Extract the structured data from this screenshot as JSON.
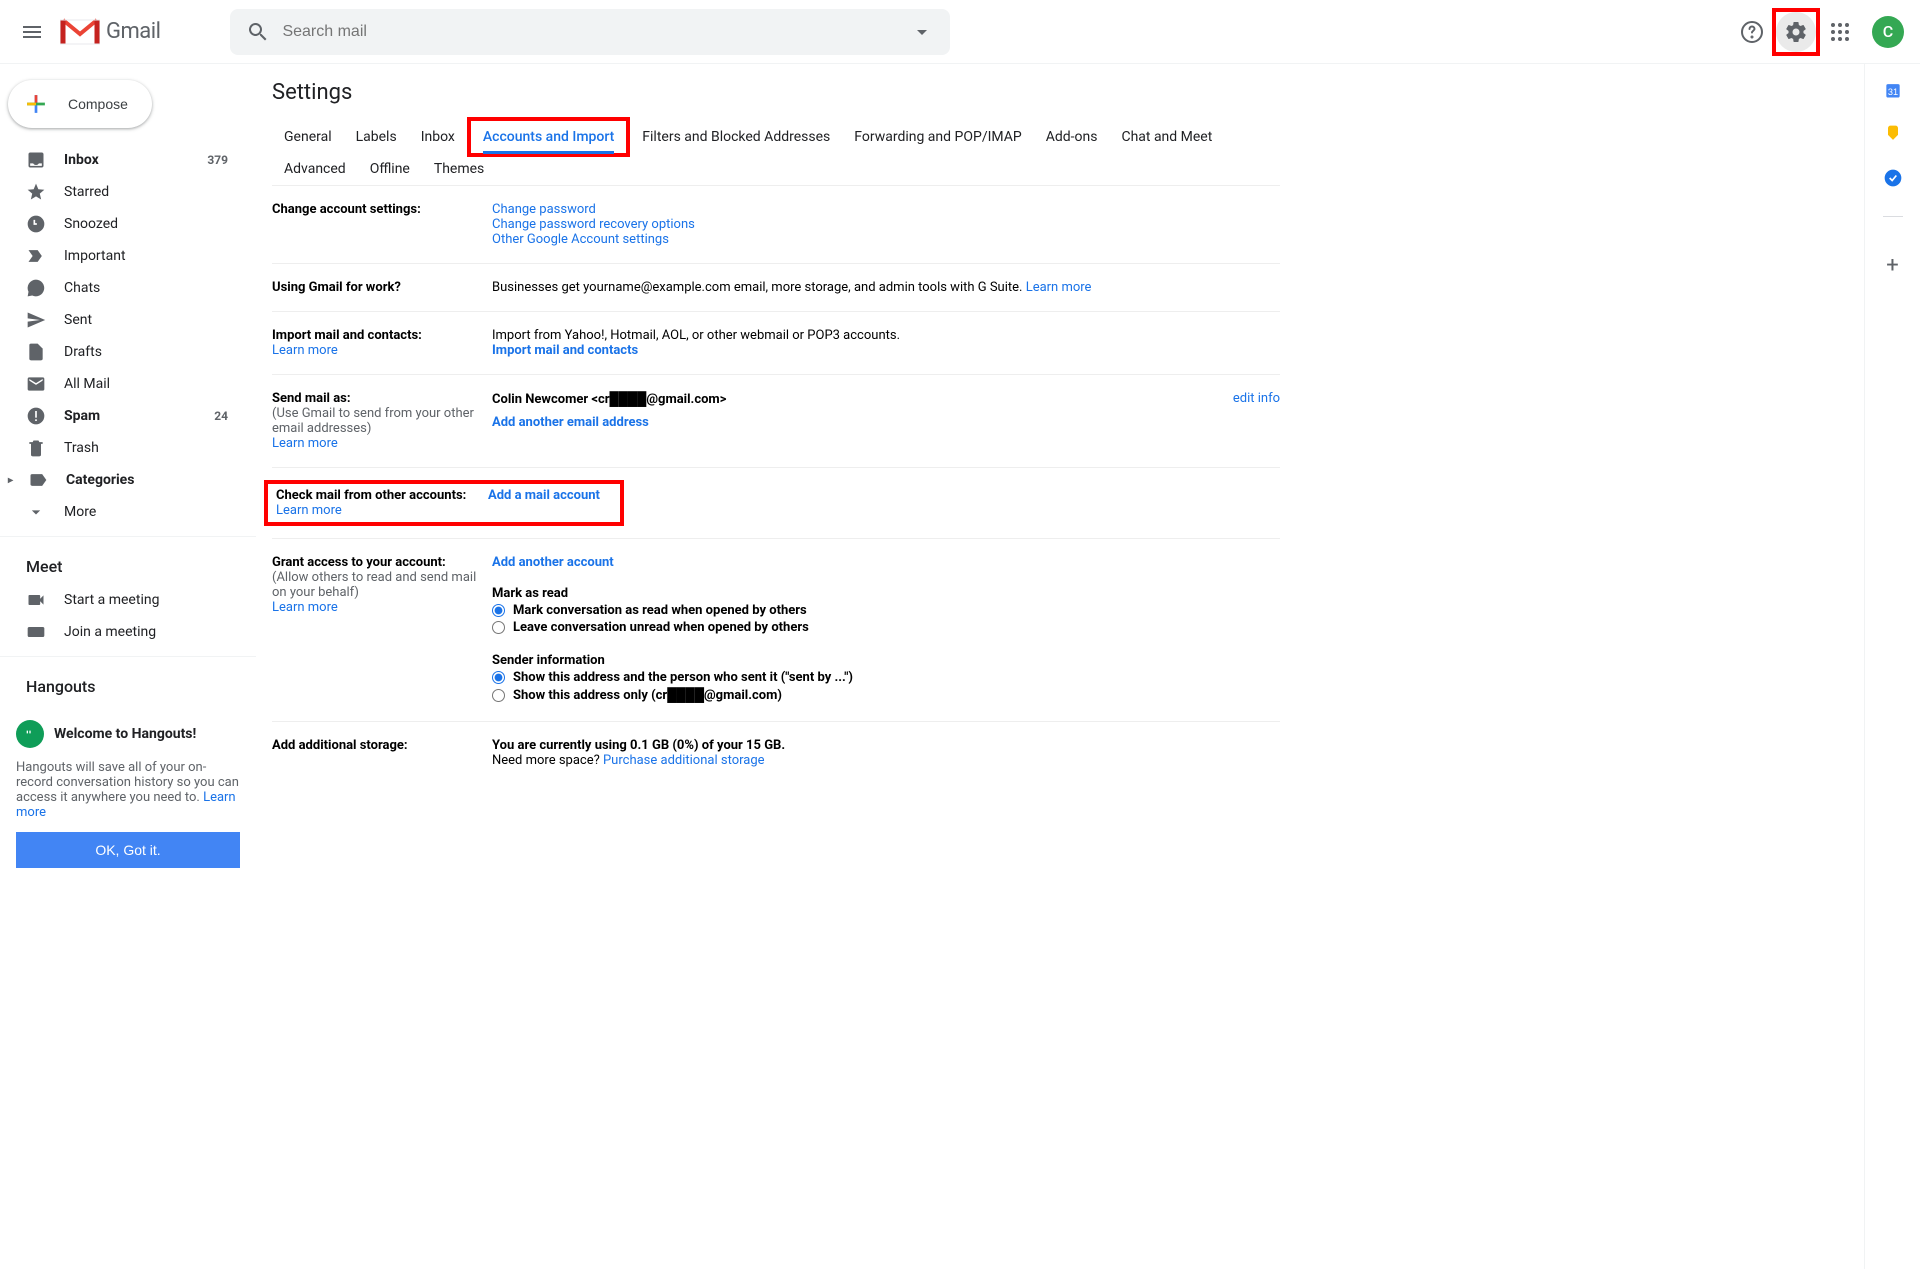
{
  "header": {
    "logo_text": "Gmail",
    "search_placeholder": "Search mail",
    "avatar_letter": "C"
  },
  "sidebar": {
    "compose": "Compose",
    "nav": [
      {
        "label": "Inbox",
        "count": "379",
        "bold": true
      },
      {
        "label": "Starred"
      },
      {
        "label": "Snoozed"
      },
      {
        "label": "Important"
      },
      {
        "label": "Chats"
      },
      {
        "label": "Sent"
      },
      {
        "label": "Drafts"
      },
      {
        "label": "All Mail"
      },
      {
        "label": "Spam",
        "count": "24",
        "bold": true
      },
      {
        "label": "Trash"
      },
      {
        "label": "Categories",
        "bold": true,
        "chevron": true
      },
      {
        "label": "More",
        "expand_icon": true
      }
    ],
    "meet_title": "Meet",
    "meet_start": "Start a meeting",
    "meet_join": "Join a meeting",
    "hangouts_title": "Hangouts",
    "hangouts_welcome": "Welcome to Hangouts!",
    "hangouts_body": "Hangouts will save all of your on-record conversation history so you can access it anywhere you need to. ",
    "hangouts_learn": "Learn more",
    "hangouts_ok": "OK, Got it."
  },
  "settings": {
    "title": "Settings",
    "tabs": [
      "General",
      "Labels",
      "Inbox",
      "Accounts and Import",
      "Filters and Blocked Addresses",
      "Forwarding and POP/IMAP",
      "Add-ons",
      "Chat and Meet",
      "Advanced",
      "Offline",
      "Themes"
    ],
    "active_tab": "Accounts and Import",
    "sections": {
      "change_account": {
        "label": "Change account settings:",
        "links": [
          "Change password",
          "Change password recovery options",
          "Other Google Account settings"
        ]
      },
      "gmail_work": {
        "label": "Using Gmail for work?",
        "text": "Businesses get yourname@example.com email, more storage, and admin tools with G Suite. ",
        "learn": "Learn more"
      },
      "import_mail": {
        "label": "Import mail and contacts:",
        "learn": "Learn more",
        "text": "Import from Yahoo!, Hotmail, AOL, or other webmail or POP3 accounts.",
        "action": "Import mail and contacts"
      },
      "send_as": {
        "label": "Send mail as:",
        "sub": "(Use Gmail to send from your other email addresses)",
        "learn": "Learn more",
        "name": "Colin Newcomer <cr████@gmail.com>",
        "action": "Add another email address",
        "edit": "edit info"
      },
      "check_mail": {
        "label": "Check mail from other accounts:",
        "learn": "Learn more",
        "action": "Add a mail account"
      },
      "grant_access": {
        "label": "Grant access to your account:",
        "sub": "(Allow others to read and send mail on your behalf)",
        "learn": "Learn more",
        "action": "Add another account",
        "mark_title": "Mark as read",
        "mark_opt1": "Mark conversation as read when opened by others",
        "mark_opt2": "Leave conversation unread when opened by others",
        "sender_title": "Sender information",
        "sender_opt1": "Show this address and the person who sent it (\"sent by ...\")",
        "sender_opt2": "Show this address only (cr████@gmail.com)"
      },
      "storage": {
        "label": "Add additional storage:",
        "text": "You are currently using 0.1 GB (0%) of your 15 GB.",
        "more": "Need more space? ",
        "purchase": "Purchase additional storage"
      }
    }
  }
}
